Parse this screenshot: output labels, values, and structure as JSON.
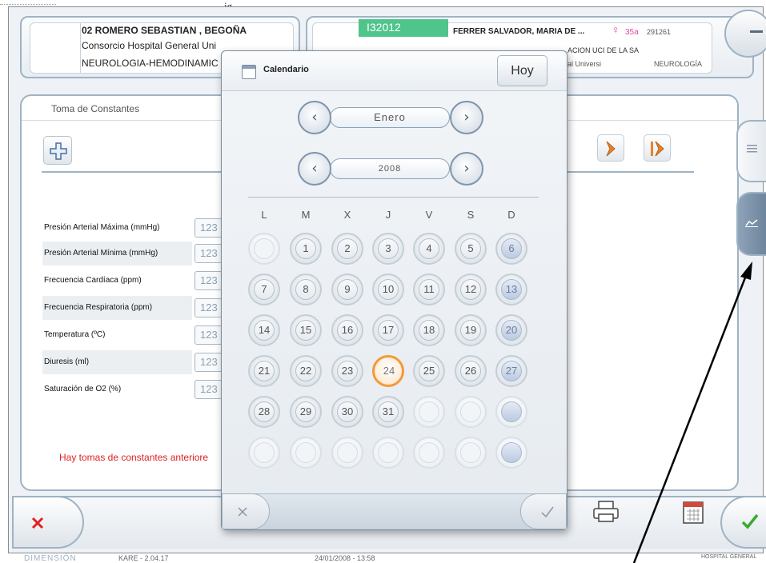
{
  "patient": {
    "name": "02 ROMERO SEBASTIAN , BEGOÑA",
    "hospital": "Consorcio Hospital General Uni",
    "unit": "NEUROLOGIA-HEMODINAMIC"
  },
  "episode": {
    "id": "I32012",
    "physician": "FERRER SALVADOR, MARIA DE ...",
    "gender_symbol": "♀",
    "age": "35a",
    "record": "291261",
    "line2": "ACION UCI DE LA SA",
    "line3_left": "al Universi",
    "line3_right": "NEUROLOGÍA"
  },
  "top_caption": "ig",
  "main": {
    "title": "Toma de Constantes",
    "warning": "Hay tomas de constantes anteriore",
    "vitals": [
      {
        "label": "Presión Arterial Máxima (mmHg)",
        "value": "123"
      },
      {
        "label": "Presión Arterial Mínima (mmHg)",
        "value": "123"
      },
      {
        "label": "Frecuencia Cardíaca (ppm)",
        "value": "123"
      },
      {
        "label": "Frecuencia Respiratoria (ppm)",
        "value": "123"
      },
      {
        "label": "Temperatura (ºC)",
        "value": "123"
      },
      {
        "label": "Diuresis (ml)",
        "value": "123"
      },
      {
        "label": "Saturación de O2 (%)",
        "value": "123"
      }
    ]
  },
  "calendar": {
    "title": "Calendario",
    "today_label": "Hoy",
    "month": "Enero",
    "year": "2008",
    "weekdays": [
      "L",
      "M",
      "X",
      "J",
      "V",
      "S",
      "D"
    ],
    "selected_day": "24",
    "days": [
      "",
      "1",
      "2",
      "3",
      "4",
      "5",
      "6",
      "7",
      "8",
      "9",
      "10",
      "11",
      "12",
      "13",
      "14",
      "15",
      "16",
      "17",
      "18",
      "19",
      "20",
      "21",
      "22",
      "23",
      "24",
      "25",
      "26",
      "27",
      "28",
      "29",
      "30",
      "31",
      "",
      "",
      "",
      "",
      "",
      "",
      "",
      "",
      "",
      ""
    ]
  },
  "footer": {
    "brand": "DIMENSIÓN",
    "version": "KARE - 2.04.17",
    "datetime": "24/01/2008 - 13:58",
    "hospital": "HOSPITAL GENERAL"
  },
  "colors": {
    "accent_green": "#4fc48b",
    "warning_red": "#e02020",
    "selected_orange": "#f29a37",
    "frame_blue": "#9fb3c4"
  }
}
